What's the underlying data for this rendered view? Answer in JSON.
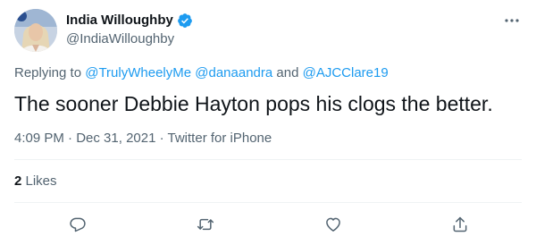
{
  "author": {
    "display_name": "India Willoughby",
    "handle": "@IndiaWilloughby",
    "verified_icon": "verified-badge-icon"
  },
  "reply_context": {
    "prefix": "Replying to ",
    "mention1": "@TrulyWheelyMe",
    "mention2": "@danaandra",
    "joiner": " and ",
    "mention3": "@AJCClare19"
  },
  "tweet": {
    "text": "The sooner Debbie Hayton pops his clogs the better."
  },
  "meta": {
    "time": "4:09 PM",
    "separator1": " · ",
    "date": "Dec 31, 2021",
    "separator2": " · ",
    "source": "Twitter for iPhone"
  },
  "engagement": {
    "likes_count": "2",
    "likes_label": " Likes"
  },
  "actions": [
    "reply-icon",
    "retweet-icon",
    "like-icon",
    "share-icon"
  ],
  "colors": {
    "accent": "#1d9bf0",
    "text_primary": "#0f1419",
    "text_secondary": "#536471",
    "divider": "#eff3f4"
  }
}
